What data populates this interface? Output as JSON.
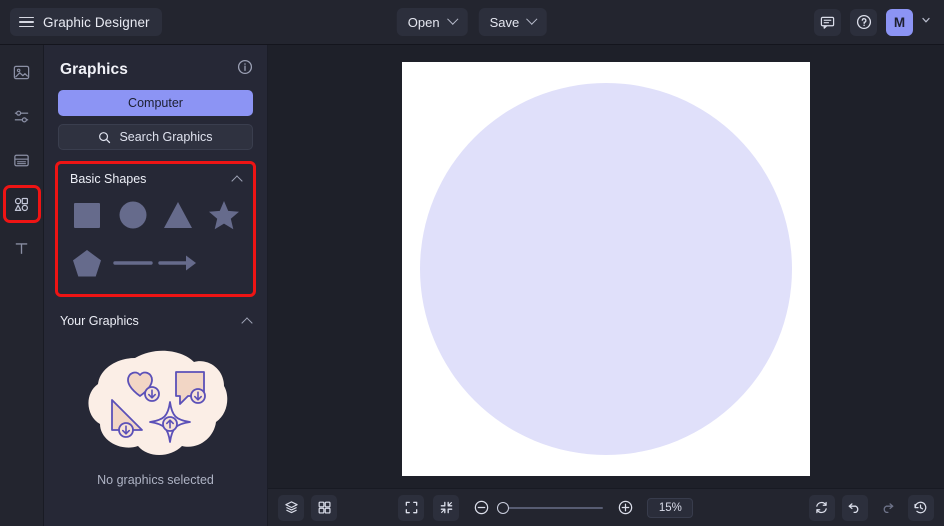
{
  "topbar": {
    "app_title": "Graphic Designer",
    "menu_icon": "hamburger-icon",
    "open_label": "Open",
    "save_label": "Save",
    "comment_icon": "comment-icon",
    "help_icon": "help-circle-icon",
    "avatar_initial": "M",
    "avatar_color": "#8c94f4"
  },
  "rail": {
    "items": [
      {
        "name": "image-icon",
        "active": false
      },
      {
        "name": "adjustments-icon",
        "active": false
      },
      {
        "name": "layout-icon",
        "active": false
      },
      {
        "name": "shapes-icon",
        "active": true
      },
      {
        "name": "text-icon",
        "active": false
      }
    ]
  },
  "panel": {
    "title": "Graphics",
    "info_icon": "info-circle-icon",
    "computer_label": "Computer",
    "search_label": "Search Graphics",
    "search_icon": "search-icon",
    "basic_shapes": {
      "label": "Basic Shapes",
      "collapse_icon": "chevron-up-icon",
      "highlighted": true,
      "shapes": [
        {
          "name": "square-shape",
          "label": "Square"
        },
        {
          "name": "circle-shape",
          "label": "Circle"
        },
        {
          "name": "triangle-shape",
          "label": "Triangle"
        },
        {
          "name": "star-shape",
          "label": "Star"
        },
        {
          "name": "pentagon-shape",
          "label": "Pentagon"
        },
        {
          "name": "line-shape",
          "label": "Line"
        },
        {
          "name": "arrow-shape",
          "label": "Arrow"
        }
      ],
      "shape_color": "#666b8c"
    },
    "your_graphics": {
      "label": "Your Graphics",
      "collapse_icon": "chevron-up-icon",
      "empty_text": "No graphics selected",
      "illustration": "empty-graphics-illustration"
    }
  },
  "canvas": {
    "artboard_background": "#ffffff",
    "circle_color": "#e0e0fa",
    "stage_background": "#1e2029"
  },
  "bottombar": {
    "layers_icon": "layers-icon",
    "grid_icon": "grid-icon",
    "fit_icon": "fit-to-screen-icon",
    "collapse_icon": "zoom-to-fit-icon",
    "zoom_out_icon": "zoom-out-icon",
    "zoom_in_icon": "zoom-in-icon",
    "zoom_level": "15%",
    "refresh_icon": "reset-icon",
    "undo_icon": "undo-icon",
    "redo_icon": "redo-icon",
    "history_icon": "history-icon"
  },
  "colors": {
    "accent": "#8c94f4",
    "highlight_box": "#ee1414",
    "topbar_bg": "#23252f",
    "panel_bg": "#262836"
  }
}
